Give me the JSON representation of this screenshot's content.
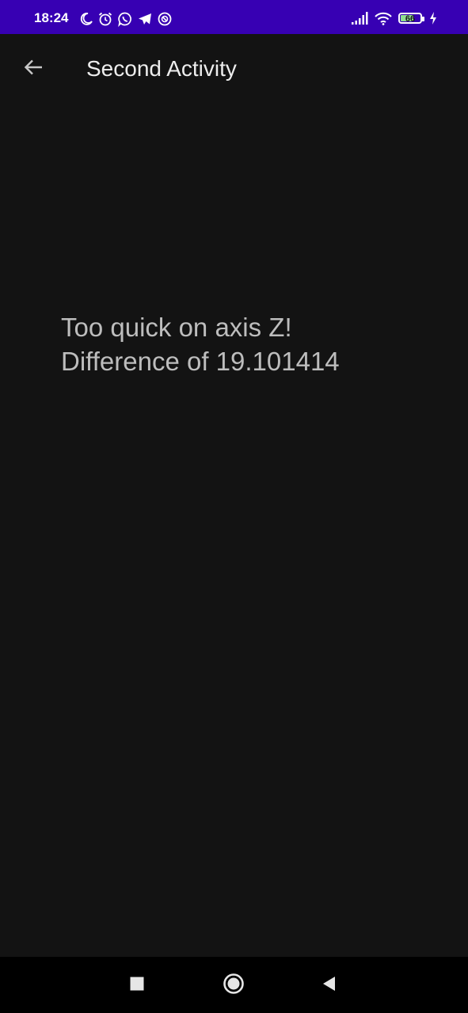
{
  "status_bar": {
    "time": "18:24",
    "left_icons": [
      "moon-icon",
      "alarm-icon",
      "whatsapp-icon",
      "telegram-icon",
      "vpn-icon"
    ],
    "right_icons": [
      "signal-icon",
      "wifi-icon",
      "battery-icon",
      "charging-icon"
    ],
    "battery_level": "66",
    "battery_fraction": 0.66,
    "background_color": "#3700b3"
  },
  "app_bar": {
    "title": "Second Activity",
    "back_icon": "arrow-back-icon"
  },
  "content": {
    "message": "Too quick on axis Z!\nDifference of 19.101414",
    "line1": "Too quick on axis Z!",
    "line2": "Difference of 19.101414"
  },
  "nav_bar": {
    "buttons": [
      "recents-icon",
      "home-icon",
      "back-icon"
    ]
  }
}
